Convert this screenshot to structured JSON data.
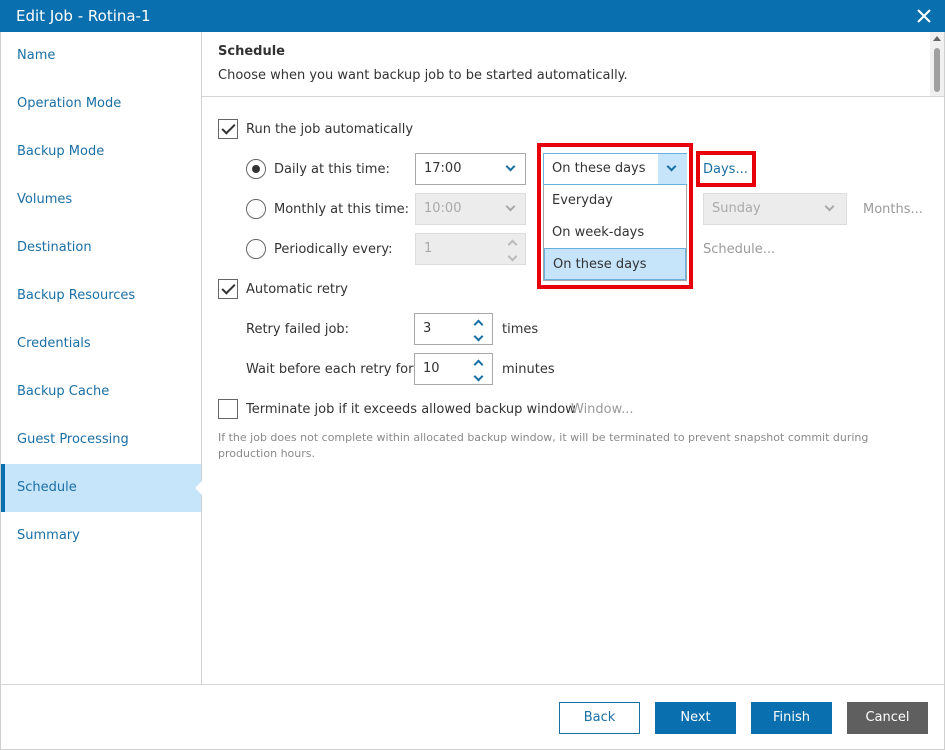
{
  "window": {
    "title": "Edit Job - Rotina-1"
  },
  "sidebar": {
    "items": [
      {
        "label": "Name"
      },
      {
        "label": "Operation Mode"
      },
      {
        "label": "Backup Mode"
      },
      {
        "label": "Volumes"
      },
      {
        "label": "Destination"
      },
      {
        "label": "Backup Resources"
      },
      {
        "label": "Credentials"
      },
      {
        "label": "Backup Cache"
      },
      {
        "label": "Guest Processing"
      },
      {
        "label": "Schedule",
        "active": true
      },
      {
        "label": "Summary"
      }
    ]
  },
  "header": {
    "title": "Schedule",
    "subtitle": "Choose when you want backup job to be started automatically."
  },
  "schedule": {
    "run_auto": {
      "label": "Run the job automatically",
      "checked": true
    },
    "daily": {
      "label": "Daily at this time:",
      "time": "17:00",
      "days_select": "On these days",
      "days_link": "Days..."
    },
    "monthly": {
      "label": "Monthly at this time:",
      "time": "10:00",
      "day_select": "Sunday",
      "months_link": "Months..."
    },
    "periodic": {
      "label": "Periodically every:",
      "value": "1",
      "schedule_link": "Schedule..."
    },
    "dropdown_options": [
      "Everyday",
      "On week-days",
      "On these days"
    ],
    "dropdown_selected": "On these days"
  },
  "retry": {
    "label": "Automatic retry",
    "checked": true,
    "failed_label": "Retry failed job:",
    "failed_value": "3",
    "failed_unit": "times",
    "wait_label": "Wait before each retry for:",
    "wait_value": "10",
    "wait_unit": "minutes"
  },
  "terminate": {
    "label": "Terminate job if it exceeds allowed backup window",
    "checked": false,
    "window_link": "Window...",
    "note": "If the job does not complete within allocated backup window, it will be terminated to prevent snapshot commit during production hours."
  },
  "footer": {
    "back": "Back",
    "next": "Next",
    "finish": "Finish",
    "cancel": "Cancel"
  },
  "colors": {
    "accent": "#0a6fae",
    "highlight": "#e8000b",
    "selected_bg": "#c6e4fa"
  }
}
